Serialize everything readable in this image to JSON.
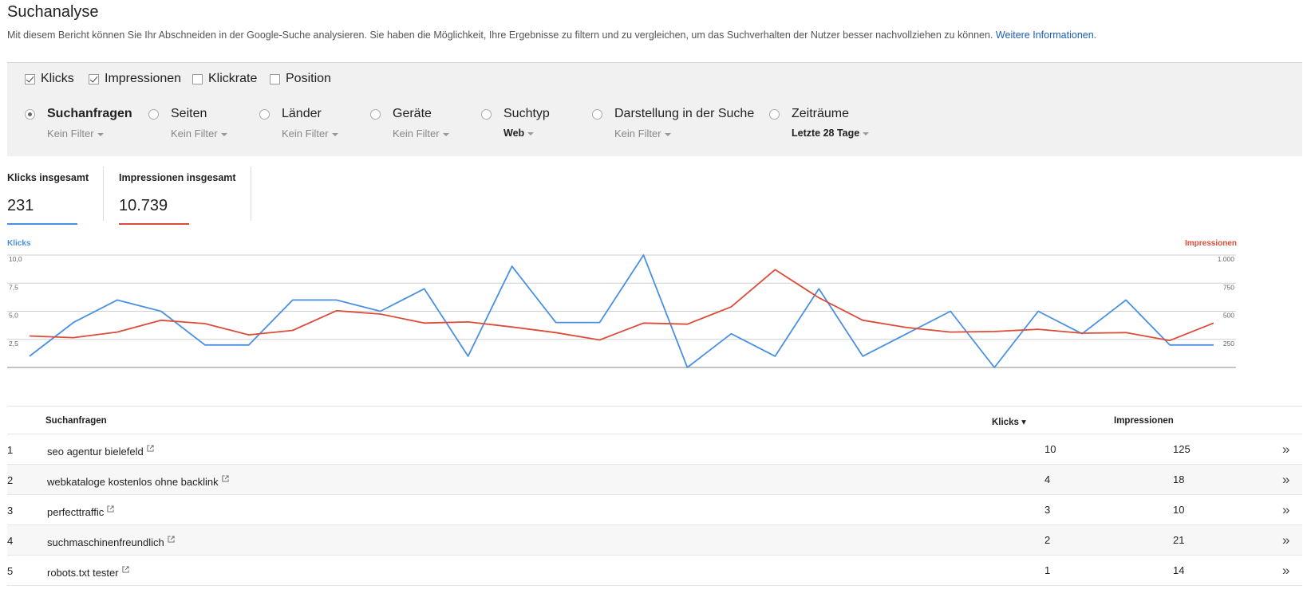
{
  "header": {
    "title": "Suchanalyse",
    "description": "Mit diesem Bericht können Sie Ihr Abschneiden in der Google-Suche analysieren. Sie haben die Möglichkeit, Ihre Ergebnisse zu filtern und zu vergleichen, um das Suchverhalten der Nutzer besser nachvollziehen zu können.",
    "link": "Weitere Informationen."
  },
  "metrics": [
    {
      "label": "Klicks",
      "checked": true
    },
    {
      "label": "Impressionen",
      "checked": true
    },
    {
      "label": "Klickrate",
      "checked": false
    },
    {
      "label": "Position",
      "checked": false
    }
  ],
  "dimensions": [
    {
      "label": "Suchanfragen",
      "filter": "Kein Filter",
      "selected": true
    },
    {
      "label": "Seiten",
      "filter": "Kein Filter",
      "selected": false
    },
    {
      "label": "Länder",
      "filter": "Kein Filter",
      "selected": false
    },
    {
      "label": "Geräte",
      "filter": "Kein Filter",
      "selected": false
    },
    {
      "label": "Suchtyp",
      "filter": "Web",
      "selected": false
    },
    {
      "label": "Darstellung in der Suche",
      "filter": "Kein Filter",
      "selected": false
    },
    {
      "label": "Zeiträume",
      "filter": "Letzte 28 Tage",
      "selected": false
    }
  ],
  "totals": {
    "clicks_label": "Klicks insgesamt",
    "clicks_value": "231",
    "impressions_label": "Impressionen insgesamt",
    "impressions_value": "10.739"
  },
  "colors": {
    "clicks": "#4a90e2",
    "impressions": "#dd4b39"
  },
  "chart_data": {
    "type": "line",
    "left_axis_label": "Klicks",
    "right_axis_label": "Impressionen",
    "left_ticks": [
      "10,0",
      "7,5",
      "5,0",
      "2,5"
    ],
    "right_ticks": [
      "1.000",
      "750",
      "500",
      "250"
    ],
    "ylim_left": [
      0,
      10
    ],
    "ylim_right": [
      0,
      1000
    ],
    "grid": true,
    "series": [
      {
        "name": "Klicks",
        "axis": "left",
        "values": [
          1,
          4,
          6,
          5,
          2,
          2,
          6,
          6,
          5,
          7,
          1,
          9,
          4,
          4,
          10,
          0,
          3,
          1,
          7,
          1,
          3,
          5,
          0,
          5,
          3,
          6,
          2,
          2
        ]
      },
      {
        "name": "Impressionen",
        "axis": "right",
        "values": [
          280,
          265,
          315,
          420,
          390,
          290,
          330,
          505,
          475,
          395,
          405,
          360,
          310,
          245,
          395,
          385,
          540,
          870,
          620,
          420,
          355,
          315,
          320,
          340,
          305,
          310,
          240,
          395
        ]
      }
    ]
  },
  "table": {
    "headers": {
      "query": "Suchanfragen",
      "clicks": "Klicks ▾",
      "impressions": "Impressionen"
    },
    "rows": [
      {
        "num": "1",
        "query": "seo agentur bielefeld",
        "clicks": "10",
        "impressions": "125"
      },
      {
        "num": "2",
        "query": "webkataloge kostenlos ohne backlink",
        "clicks": "4",
        "impressions": "18"
      },
      {
        "num": "3",
        "query": "perfecttraffic",
        "clicks": "3",
        "impressions": "10"
      },
      {
        "num": "4",
        "query": "suchmaschinenfreundlich",
        "clicks": "2",
        "impressions": "21"
      },
      {
        "num": "5",
        "query": "robots.txt tester",
        "clicks": "1",
        "impressions": "14"
      }
    ],
    "row_action": "»"
  }
}
